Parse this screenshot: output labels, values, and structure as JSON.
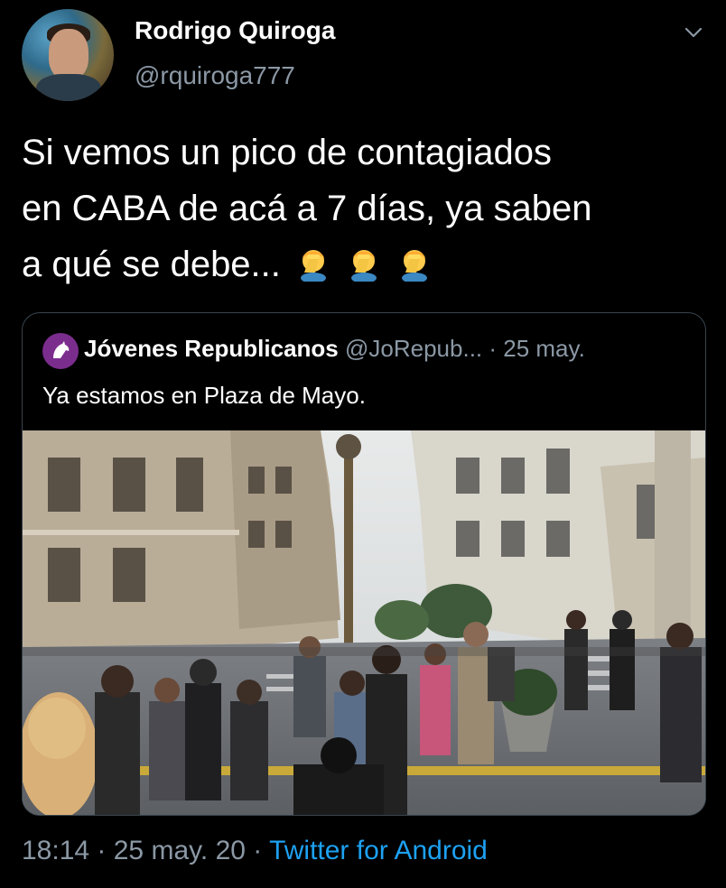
{
  "tweet": {
    "author_name": "Rodrigo Quiroga",
    "author_handle": "@rquiroga777",
    "text_lines": [
      "Si vemos un pico de contagiados",
      "en CABA de acá a 7 días, ya saben",
      "a qué se debe..."
    ],
    "emojis": [
      "facepalm-emoji",
      "facepalm-emoji",
      "facepalm-emoji"
    ],
    "time": "18:14",
    "date": "25 may. 20",
    "separator": " · ",
    "source": "Twitter for Android"
  },
  "quoted_tweet": {
    "author_name": "Jóvenes Republicanos",
    "author_handle": "@JoRepub...",
    "date": "25 may.",
    "separator": " · ",
    "text": "Ya estamos en Plaza de Mayo.",
    "media": "street-crowd-photo"
  },
  "icons": {
    "menu": "chevron-down-icon",
    "quote_avatar": "horse-logo"
  },
  "colors": {
    "background": "#000000",
    "secondary_text": "#8b98a5",
    "link": "#1da1f2",
    "border": "#38444d"
  }
}
